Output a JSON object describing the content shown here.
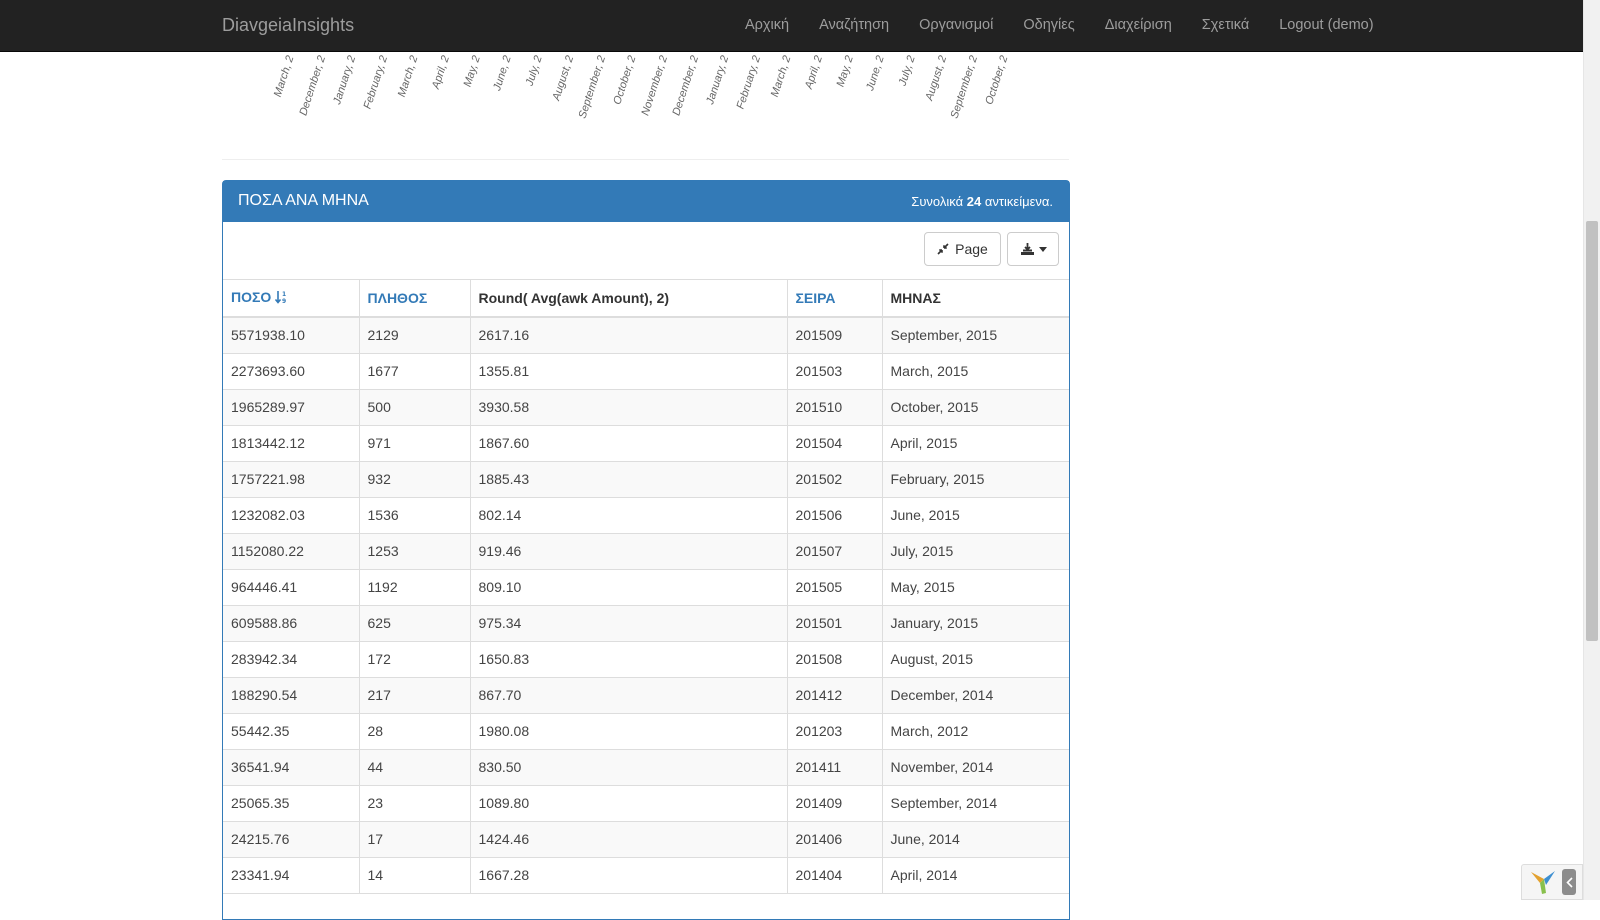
{
  "navbar": {
    "brand": "DiavgeiaInsights",
    "items": [
      "Αρχική",
      "Αναζήτηση",
      "Οργανισμοί",
      "Οδηγίες",
      "Διαχείριση",
      "Σχετικά",
      "Logout (demo)"
    ]
  },
  "chart_axis": {
    "tick_labels": [
      "March, 2",
      "December, 2",
      "January, 2",
      "February, 2",
      "March, 2",
      "April, 2",
      "May, 2",
      "June, 2",
      "July, 2",
      "August, 2",
      "September, 2",
      "October, 2",
      "November, 2",
      "December, 2",
      "January, 2",
      "February, 2",
      "March, 2",
      "April, 2",
      "May, 2",
      "June, 2",
      "July, 2",
      "August, 2",
      "September, 2",
      "October, 2"
    ]
  },
  "panel": {
    "title": "ΠΟΣΑ ΑΝΑ ΜΗΝΑ",
    "summary_prefix": "Συνολικά ",
    "summary_count": "24",
    "summary_suffix": " αντικείμενα.",
    "page_button": "Page"
  },
  "table": {
    "headers": [
      "ΠΟΣΟ",
      "ΠΛΗΘΟΣ",
      "Round( Avg(awk Amount), 2)",
      "ΣΕΙΡΑ",
      "ΜΗΝΑΣ"
    ],
    "rows": [
      [
        "5571938.10",
        "2129",
        "2617.16",
        "201509",
        "September, 2015"
      ],
      [
        "2273693.60",
        "1677",
        "1355.81",
        "201503",
        "March, 2015"
      ],
      [
        "1965289.97",
        "500",
        "3930.58",
        "201510",
        "October, 2015"
      ],
      [
        "1813442.12",
        "971",
        "1867.60",
        "201504",
        "April, 2015"
      ],
      [
        "1757221.98",
        "932",
        "1885.43",
        "201502",
        "February, 2015"
      ],
      [
        "1232082.03",
        "1536",
        "802.14",
        "201506",
        "June, 2015"
      ],
      [
        "1152080.22",
        "1253",
        "919.46",
        "201507",
        "July, 2015"
      ],
      [
        "964446.41",
        "1192",
        "809.10",
        "201505",
        "May, 2015"
      ],
      [
        "609588.86",
        "625",
        "975.34",
        "201501",
        "January, 2015"
      ],
      [
        "283942.34",
        "172",
        "1650.83",
        "201508",
        "August, 2015"
      ],
      [
        "188290.54",
        "217",
        "867.70",
        "201412",
        "December, 2014"
      ],
      [
        "55442.35",
        "28",
        "1980.08",
        "201203",
        "March, 2012"
      ],
      [
        "36541.94",
        "44",
        "830.50",
        "201411",
        "November, 2014"
      ],
      [
        "25065.35",
        "23",
        "1089.80",
        "201409",
        "September, 2014"
      ],
      [
        "24215.76",
        "17",
        "1424.46",
        "201406",
        "June, 2014"
      ],
      [
        "23341.94",
        "14",
        "1667.28",
        "201404",
        "April, 2014"
      ]
    ]
  },
  "colors": {
    "navbar_bg": "#222222",
    "primary": "#337ab7",
    "link": "#337ab7"
  }
}
